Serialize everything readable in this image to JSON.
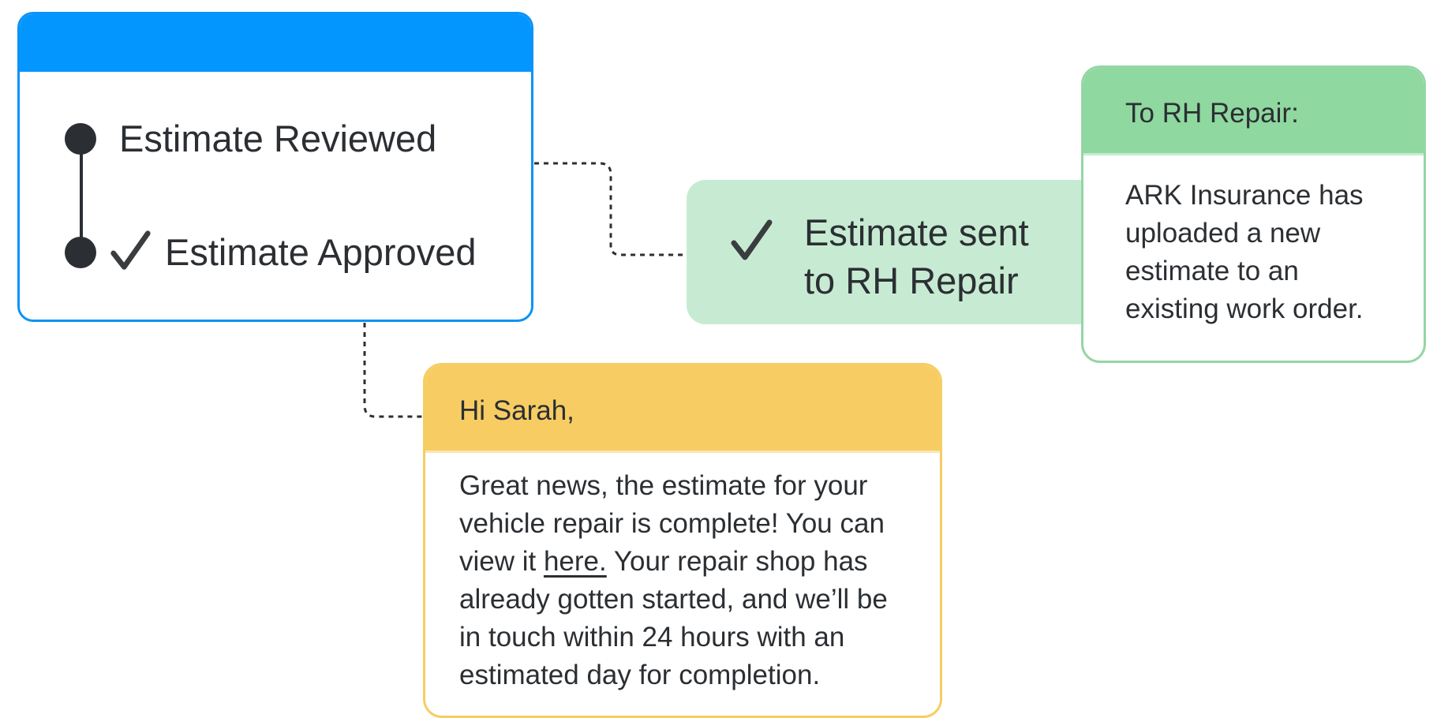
{
  "status_card": {
    "steps": [
      {
        "label": "Estimate Reviewed",
        "checked": false
      },
      {
        "label": "Estimate Approved",
        "checked": true
      }
    ],
    "accent_color": "#0396ff"
  },
  "sent_notice": {
    "line1": "Estimate sent",
    "line2": "to RH Repair",
    "icon": "check-icon",
    "color": "#c7ebd2"
  },
  "repair_note": {
    "header": "To RH Repair:",
    "lines": [
      "ARK Insurance has",
      "uploaded a new",
      "estimate to an",
      "existing work order."
    ],
    "color": "#8fd8a0"
  },
  "customer_message": {
    "greeting": "Hi Sarah,",
    "line1": "Great news, the estimate for your",
    "line2": "vehicle repair is complete! You can",
    "line3_before": "view it ",
    "link_text": "here.",
    "line3_after": " Your repair shop has",
    "line4": "already gotten started, and we’ll be",
    "line5": "in touch within 24 hours with an",
    "line6": "estimated day for completion.",
    "color": "#f7cd63"
  }
}
